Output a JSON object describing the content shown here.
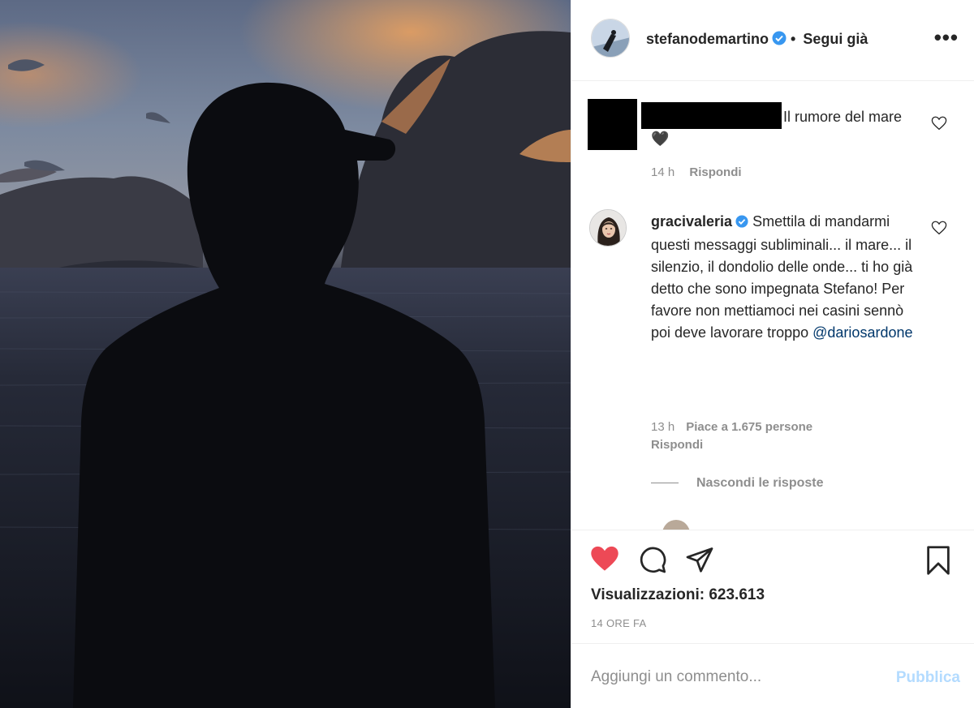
{
  "header": {
    "username": "stefanodemartino",
    "separator": "•",
    "follow_status": "Segui già",
    "more_icon": "more-icon"
  },
  "comments": [
    {
      "username_redacted": true,
      "text": "Il rumore del mare🖤",
      "time": "14 h",
      "reply_label": "Rispondi"
    },
    {
      "username": "gracivaleria",
      "verified": true,
      "text": "Smettila di mandarmi questi messaggi subliminali... il mare... il silenzio, il dondolio delle onde... ti ho già detto che sono impegnata Stefano! Per favore non mettiamoci nei casini sennò poi deve lavorare troppo",
      "mention": "@dariosardone",
      "time": "13 h",
      "likes": "Piace a 1.675 persone",
      "reply_label": "Rispondi",
      "hide_replies_label": "Nascondi le risposte"
    }
  ],
  "actions": {
    "icons": [
      "heart-filled-icon",
      "comment-icon",
      "share-icon",
      "bookmark-icon"
    ],
    "views": "Visualizzazioni: 623.613",
    "posted_ago": "14 ORE FA"
  },
  "add_comment": {
    "placeholder": "Aggiungi un commento...",
    "publish_label": "Pubblica"
  },
  "colors": {
    "like_red": "#ed4956",
    "link_blue": "#00376b",
    "publish_disabled": "#b3dbff",
    "verified_blue": "#3897f0"
  }
}
